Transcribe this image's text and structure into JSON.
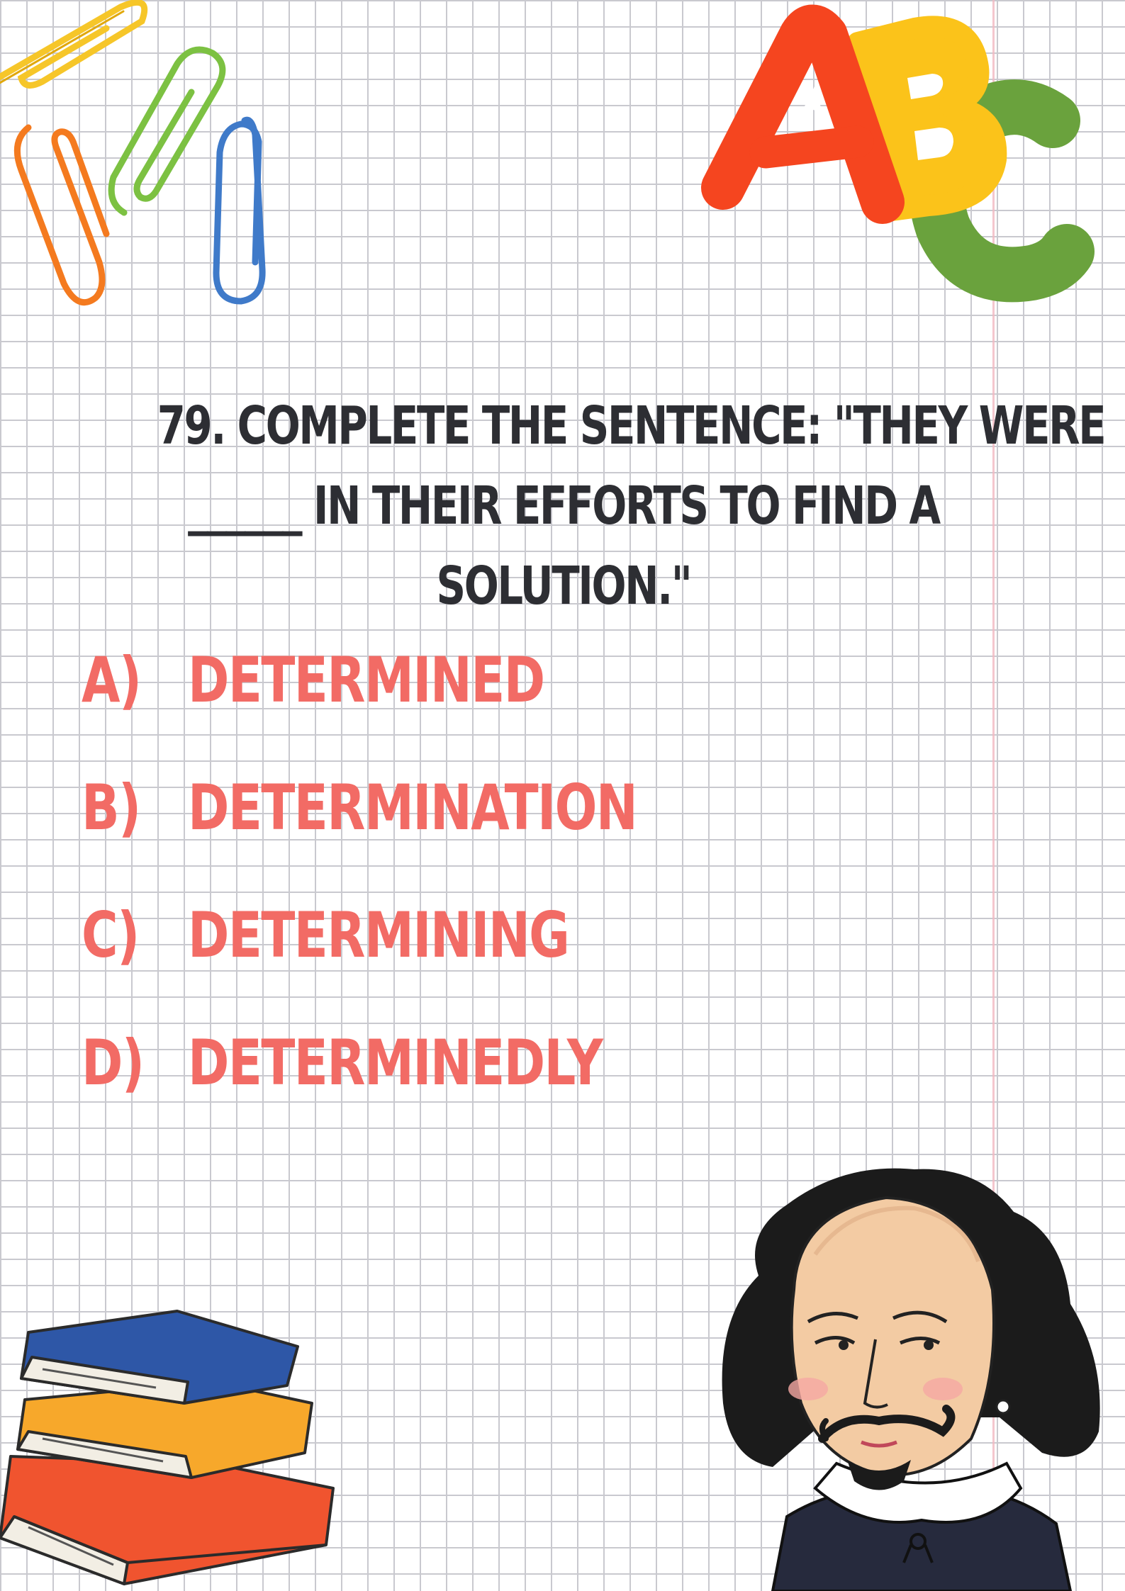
{
  "question": {
    "lines": [
      "79. COMPLETE THE SENTENCE: \"THEY WERE",
      "______ IN THEIR EFFORTS TO FIND A",
      "SOLUTION.\""
    ]
  },
  "options": [
    {
      "letter": "A)",
      "text": "DETERMINED"
    },
    {
      "letter": "B)",
      "text": "DETERMINATION"
    },
    {
      "letter": "C)",
      "text": "DETERMINING"
    },
    {
      "letter": "D)",
      "text": "DETERMINEDLY"
    }
  ],
  "decorations": {
    "abc_letters": [
      "A",
      "B",
      "C"
    ],
    "icons": [
      "paperclip-icon",
      "abc-blocks-icon",
      "book-stack-icon",
      "shakespeare-illustration"
    ]
  },
  "colors": {
    "question_text": "#2d2e33",
    "option_text": "#f26b65",
    "grid": "#c9c9cf",
    "letter_a": "#f5451f",
    "letter_b": "#fbc31a",
    "letter_c": "#6aa23d"
  }
}
